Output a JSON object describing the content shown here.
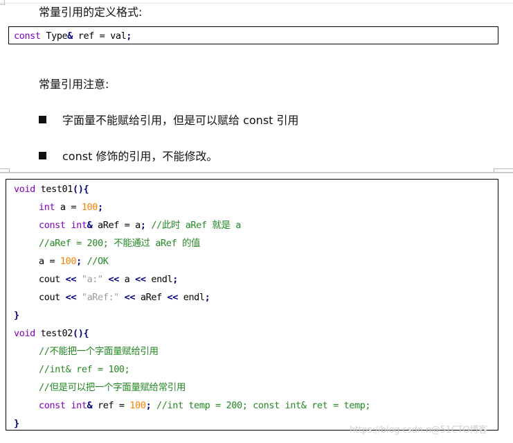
{
  "section1": {
    "heading": "常量引用的定义格式:",
    "code": [
      {
        "t": "const",
        "c": "kw"
      },
      {
        "t": " Type",
        "c": "plain"
      },
      {
        "t": "&",
        "c": "op"
      },
      {
        "t": " ref = val",
        "c": "plain"
      },
      {
        "t": ";",
        "c": "op"
      }
    ]
  },
  "section2": {
    "heading": "常量引用注意:",
    "bullets": [
      "字面量不能赋给引用，但是可以赋给 const 引用",
      "const 修饰的引用，不能修改。"
    ]
  },
  "code_block": {
    "lines": [
      {
        "indent": 0,
        "tokens": [
          {
            "t": "void",
            "c": "kw"
          },
          {
            "t": " test01",
            "c": "plain"
          },
          {
            "t": "(){",
            "c": "brace"
          }
        ]
      },
      {
        "indent": 1,
        "tokens": [
          {
            "t": "int",
            "c": "kw"
          },
          {
            "t": " a = ",
            "c": "plain"
          },
          {
            "t": "100",
            "c": "num"
          },
          {
            "t": ";",
            "c": "op"
          }
        ]
      },
      {
        "indent": 1,
        "tokens": [
          {
            "t": "const int",
            "c": "kw"
          },
          {
            "t": "&",
            "c": "op"
          },
          {
            "t": " aRef = a",
            "c": "plain"
          },
          {
            "t": ";",
            "c": "op"
          },
          {
            "t": " //此时 aRef 就是 a",
            "c": "cm"
          }
        ]
      },
      {
        "indent": 1,
        "tokens": [
          {
            "t": "//aRef = 200; 不能通过 aRef 的值",
            "c": "cm"
          }
        ]
      },
      {
        "indent": 1,
        "tokens": [
          {
            "t": "a = ",
            "c": "plain"
          },
          {
            "t": "100",
            "c": "num"
          },
          {
            "t": ";",
            "c": "op"
          },
          {
            "t": " //OK",
            "c": "cm"
          }
        ]
      },
      {
        "indent": 1,
        "tokens": [
          {
            "t": "cout ",
            "c": "plain"
          },
          {
            "t": "<<",
            "c": "op"
          },
          {
            "t": " \"a:\" ",
            "c": "str"
          },
          {
            "t": "<<",
            "c": "op"
          },
          {
            "t": " a ",
            "c": "plain"
          },
          {
            "t": "<<",
            "c": "op"
          },
          {
            "t": " endl",
            "c": "plain"
          },
          {
            "t": ";",
            "c": "op"
          }
        ]
      },
      {
        "indent": 1,
        "tokens": [
          {
            "t": "cout ",
            "c": "plain"
          },
          {
            "t": "<<",
            "c": "op"
          },
          {
            "t": " \"aRef:\" ",
            "c": "str"
          },
          {
            "t": "<<",
            "c": "op"
          },
          {
            "t": " aRef ",
            "c": "plain"
          },
          {
            "t": "<<",
            "c": "op"
          },
          {
            "t": " endl",
            "c": "plain"
          },
          {
            "t": ";",
            "c": "op"
          }
        ]
      },
      {
        "indent": 0,
        "tokens": [
          {
            "t": "}",
            "c": "brace"
          }
        ]
      },
      {
        "indent": 0,
        "tokens": [
          {
            "t": "void",
            "c": "kw"
          },
          {
            "t": " test02",
            "c": "plain"
          },
          {
            "t": "(){",
            "c": "brace"
          }
        ]
      },
      {
        "indent": 1,
        "tokens": [
          {
            "t": "//不能把一个字面量赋给引用",
            "c": "cm"
          }
        ]
      },
      {
        "indent": 1,
        "tokens": [
          {
            "t": "//int& ref = 100;",
            "c": "cm"
          }
        ]
      },
      {
        "indent": 1,
        "tokens": [
          {
            "t": "//但是可以把一个字面量赋给常引用",
            "c": "cm"
          }
        ]
      },
      {
        "indent": 1,
        "tokens": [
          {
            "t": "const int",
            "c": "kw"
          },
          {
            "t": "&",
            "c": "op"
          },
          {
            "t": " ref = ",
            "c": "plain"
          },
          {
            "t": "100",
            "c": "num"
          },
          {
            "t": ";",
            "c": "op"
          },
          {
            "t": " //int temp = 200; const int& ret = temp;",
            "c": "cm"
          }
        ]
      },
      {
        "indent": 0,
        "tokens": [
          {
            "t": "}",
            "c": "brace"
          }
        ]
      }
    ]
  },
  "watermark": "https://blog.csdn.n@51CTO博客"
}
